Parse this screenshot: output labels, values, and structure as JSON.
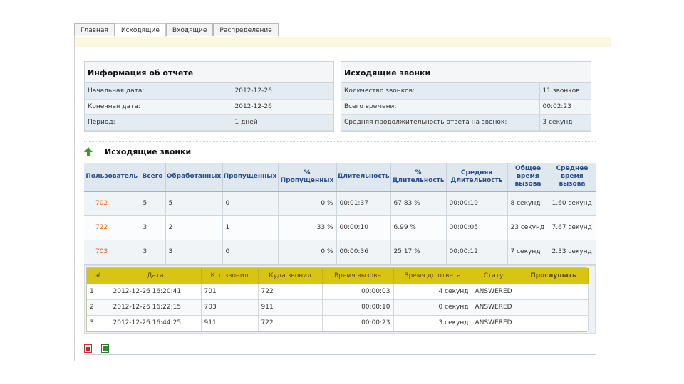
{
  "tabs": [
    "Главная",
    "Исходящие",
    "Входящие",
    "Распределение"
  ],
  "active_tab": 1,
  "report_info": {
    "title": "Информация об отчете",
    "rows": [
      {
        "label": "Начальная дата:",
        "value": "2012-12-26"
      },
      {
        "label": "Конечная дата:",
        "value": "2012-12-26"
      },
      {
        "label": "Период:",
        "value": "1 дней"
      }
    ]
  },
  "outgoing_summary": {
    "title": "Исходящие звонки",
    "rows": [
      {
        "label": "Количество звонков:",
        "value": "11 звонков"
      },
      {
        "label": "Всего времени:",
        "value": "00:02:23"
      },
      {
        "label": "Средняя продолжительность ответа на звонок:",
        "value": "3 секунд"
      }
    ]
  },
  "section": {
    "title": "Исходящие звонки",
    "icon": "green-up-arrow-icon"
  },
  "main_table": {
    "headers": [
      "Пользователь",
      "Всего",
      "Обработанных",
      "Пропущенных",
      "% Пропущенных",
      "Длительность",
      "% Длительность",
      "Средняя Длительность",
      "Общее время вызова",
      "Среднее время вызова"
    ],
    "rows": [
      {
        "user": "702",
        "total": "5",
        "handled": "5",
        "missed": "0",
        "missed_pct": "0 %",
        "duration": "00:01:37",
        "duration_pct": "67.83 %",
        "avg_duration": "00:00:19",
        "total_call": "8 секунд",
        "avg_call": "1.60 секунд"
      },
      {
        "user": "722",
        "total": "3",
        "handled": "2",
        "missed": "1",
        "missed_pct": "33 %",
        "duration": "00:00:10",
        "duration_pct": "6.99 %",
        "avg_duration": "00:00:05",
        "total_call": "23 секунд",
        "avg_call": "7.67 секунд"
      },
      {
        "user": "703",
        "total": "3",
        "handled": "3",
        "missed": "0",
        "missed_pct": "0 %",
        "duration": "00:00:36",
        "duration_pct": "25.17 %",
        "avg_duration": "00:00:12",
        "total_call": "7 секунд",
        "avg_call": "2.33 секунд"
      }
    ]
  },
  "detail_table": {
    "headers": [
      "#",
      "Дата",
      "Кто звонил",
      "Куда звонил",
      "Время вызова",
      "Время до ответа",
      "Статус",
      "Прослушать"
    ],
    "rows": [
      {
        "n": "1",
        "date": "2012-12-26 16:20:41",
        "from": "701",
        "to": "722",
        "call_time": "00:00:03",
        "wait": "4 секунд",
        "status": "ANSWERED"
      },
      {
        "n": "2",
        "date": "2012-12-26 16:22:15",
        "from": "703",
        "to": "911",
        "call_time": "00:00:10",
        "wait": "0 секунд",
        "status": "ANSWERED"
      },
      {
        "n": "3",
        "date": "2012-12-26 16:44:25",
        "from": "911",
        "to": "722",
        "call_time": "00:00:23",
        "wait": "3 секунд",
        "status": "ANSWERED"
      }
    ]
  },
  "colors": {
    "accent_link": "#e06010",
    "header_text": "#2a4f8a",
    "detail_header": "#d8c414",
    "answered": "#2a9a1a"
  }
}
